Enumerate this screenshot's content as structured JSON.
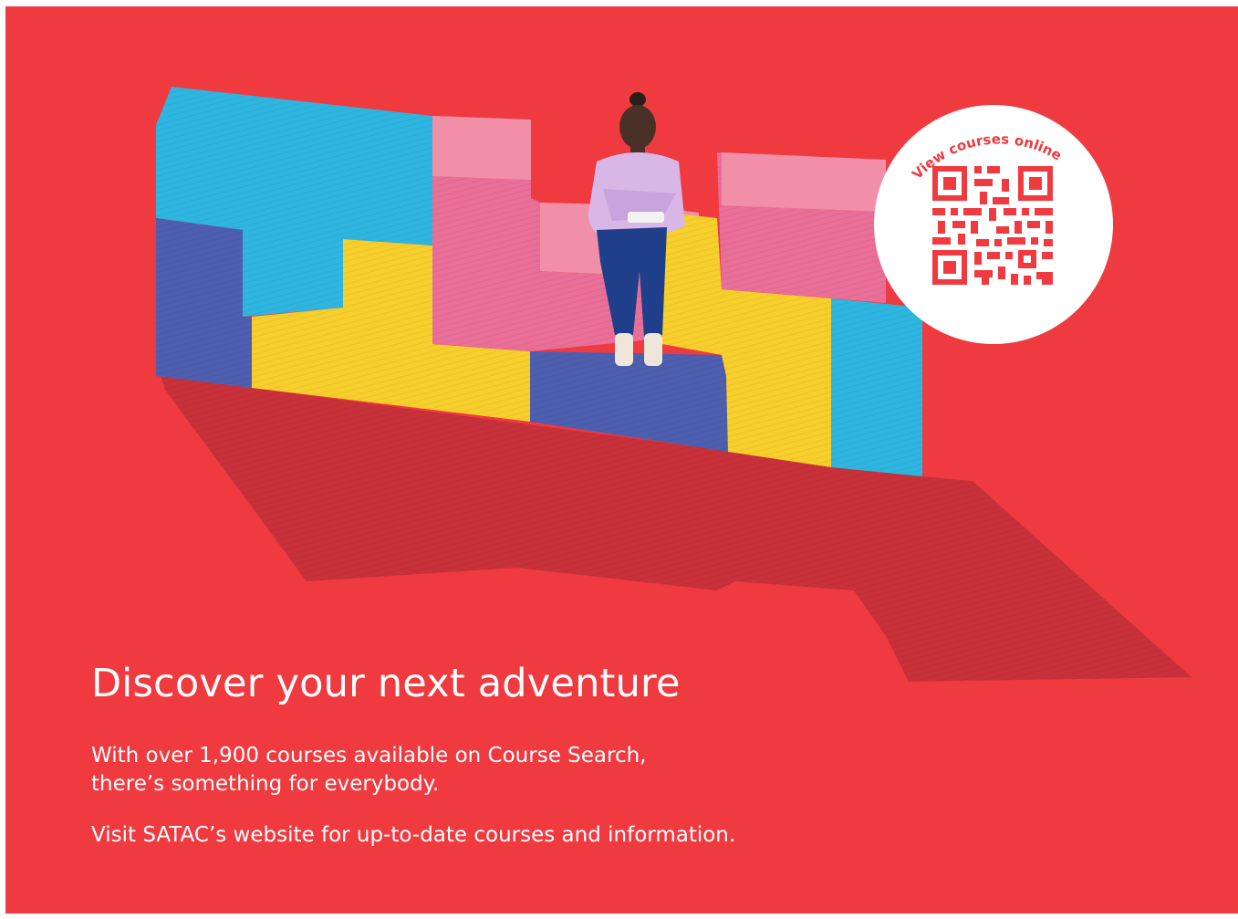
{
  "badge": {
    "curved_text": "View courses online",
    "accent_color": "#ef3a40",
    "icon": "qr-code-icon"
  },
  "headline": "Discover your next adventure",
  "body": {
    "paragraph_1_line_1": "With over 1,900 courses available on Course Search,",
    "paragraph_1_line_2": "there’s something for everybody.",
    "paragraph_2": "Visit SATAC’s website for up-to-date courses and information."
  },
  "colors": {
    "background": "#ef3a40",
    "text": "#ffffff",
    "shadow": "#c8313a",
    "block_cyan": "#2fb6e0",
    "block_navy": "#4f5fb0",
    "block_yellow": "#f7cf2c",
    "block_pink": "#ea6f98",
    "block_pink_light": "#f28fa8"
  },
  "illustration_icon": "person-on-blocks-illustration"
}
